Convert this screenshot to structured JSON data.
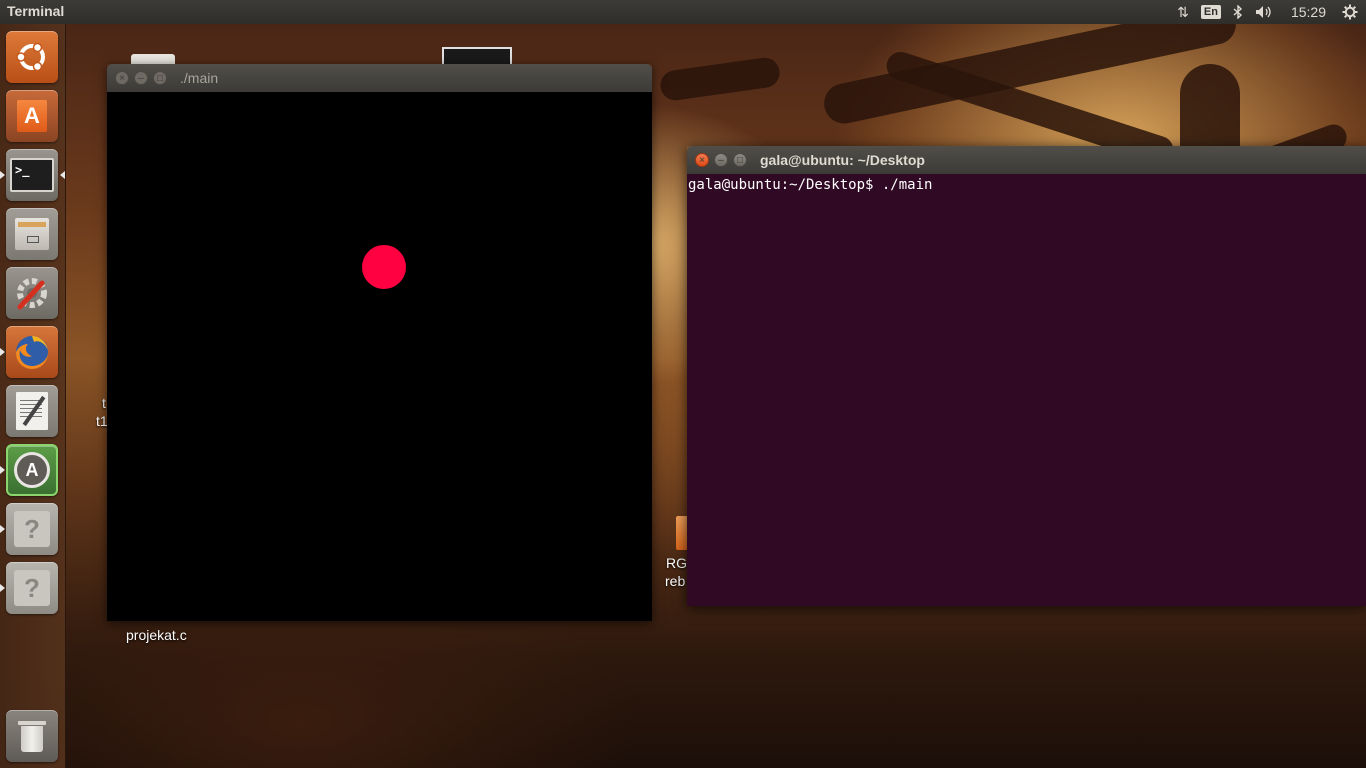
{
  "top_panel": {
    "app_title": "Terminal",
    "indicators": {
      "network_icon": "network-arrows-icon",
      "keyboard_layout": "En",
      "bluetooth_icon": "bluetooth-icon",
      "volume_icon": "volume-icon",
      "clock": "15:29",
      "system_icon": "gear-icon"
    }
  },
  "launcher": {
    "items": [
      {
        "name": "dash-home",
        "icon": "ubuntu-logo-icon",
        "color": "#c85e1e"
      },
      {
        "name": "ubuntu-software-center",
        "icon": "software-bag-icon",
        "color": "#e0672a"
      },
      {
        "name": "terminal",
        "icon": "terminal-icon",
        "color": "#3a3a3a"
      },
      {
        "name": "files",
        "icon": "file-cabinet-icon",
        "color": "#8a8680"
      },
      {
        "name": "system-settings",
        "icon": "settings-wrench-icon",
        "color": "#7a7570"
      },
      {
        "name": "firefox",
        "icon": "firefox-icon",
        "color": "#e8733a"
      },
      {
        "name": "text-editor",
        "icon": "text-editor-icon",
        "color": "#d6d3cc"
      },
      {
        "name": "software-updater",
        "icon": "software-updater-icon",
        "color": "#4a8a3a"
      },
      {
        "name": "unknown-app-1",
        "icon": "question-mark-icon",
        "color": "#a5a29c"
      },
      {
        "name": "unknown-app-2",
        "icon": "question-mark-icon",
        "color": "#a5a29c"
      },
      {
        "name": "trash",
        "icon": "trash-icon",
        "color": "#9a9690"
      }
    ]
  },
  "desktop": {
    "icons": [
      {
        "label": "projekat.c"
      },
      {
        "label_line1": "t",
        "label_line2": "t1"
      },
      {
        "label_line1": "RG",
        "label_line2": "reb"
      }
    ]
  },
  "main_window": {
    "title": "./main",
    "dot_color": "#ff0040"
  },
  "terminal_window": {
    "title": "gala@ubuntu: ~/Desktop",
    "prompt_line": "gala@ubuntu:~/Desktop$ ./main"
  },
  "colors": {
    "terminal_bg": "#300a24",
    "panel_bg": "#3c3b37",
    "accent_close": "#df4a16"
  }
}
